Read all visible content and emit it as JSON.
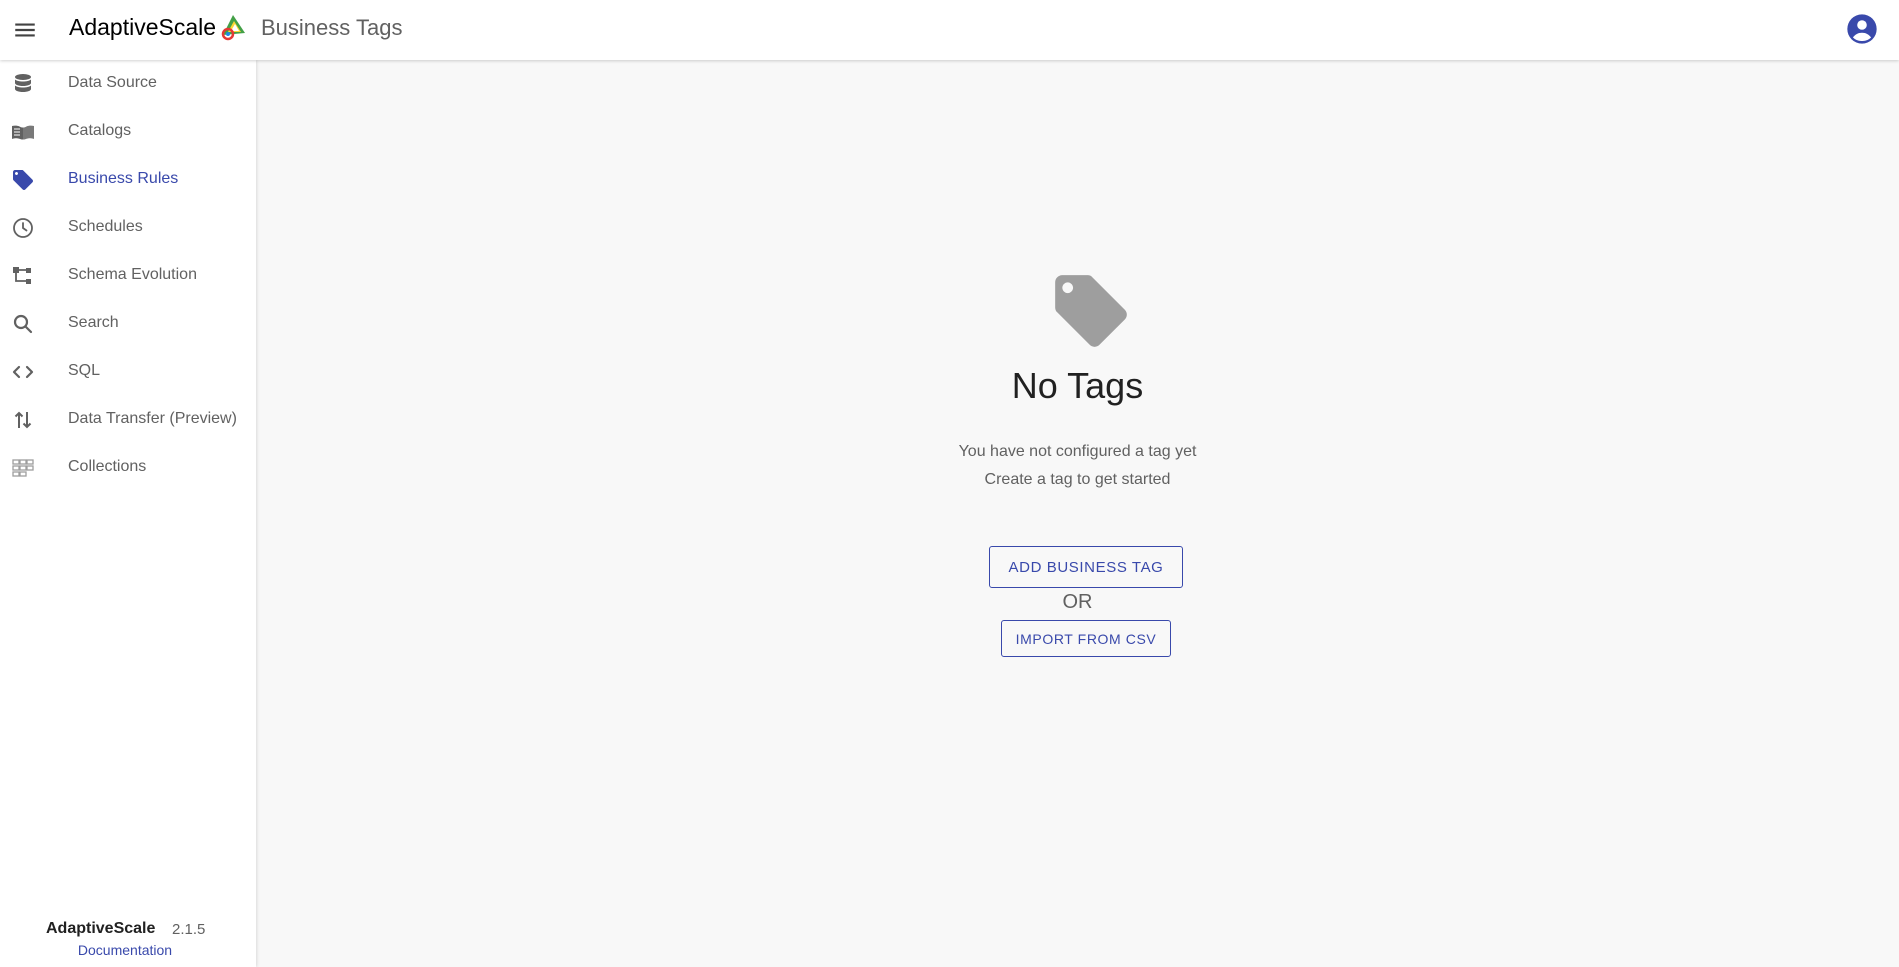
{
  "appbar": {
    "menu_icon": "menu-icon",
    "brand": "AdaptiveScale",
    "logo_icon": "adaptivescale-logo",
    "page_title": "Business Tags",
    "account_icon": "account-circle-icon"
  },
  "sidebar": {
    "items": [
      {
        "label": "Data Source",
        "icon": "database-icon",
        "active": false
      },
      {
        "label": "Catalogs",
        "icon": "book-icon",
        "active": false
      },
      {
        "label": "Business Rules",
        "icon": "tag-icon",
        "active": true
      },
      {
        "label": "Schedules",
        "icon": "clock-icon",
        "active": false
      },
      {
        "label": "Schema Evolution",
        "icon": "schema-icon",
        "active": false
      },
      {
        "label": "Search",
        "icon": "search-icon",
        "active": false
      },
      {
        "label": "SQL",
        "icon": "code-icon",
        "active": false
      },
      {
        "label": "Data Transfer (Preview)",
        "icon": "swap-vertical-icon",
        "active": false
      },
      {
        "label": "Collections",
        "icon": "collections-icon",
        "active": false
      }
    ],
    "footer": {
      "brand": "AdaptiveScale",
      "version": "2.1.5",
      "doc_link": "Documentation"
    }
  },
  "empty_state": {
    "icon": "tag-icon",
    "title": "No Tags",
    "line1": "You have not configured a tag yet",
    "line2": "Create a tag to get started",
    "add_button": "ADD BUSINESS TAG",
    "or_text": "OR",
    "import_button": "IMPORT FROM CSV"
  },
  "colors": {
    "accent": "#3949ab",
    "icon_grey": "#616161",
    "empty_icon_grey": "#9e9e9e",
    "background": "#f8f8f8"
  }
}
